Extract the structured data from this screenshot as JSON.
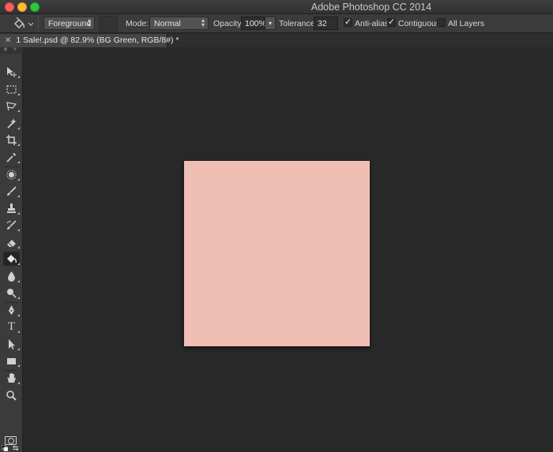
{
  "app": {
    "title": "Adobe Photoshop CC 2014"
  },
  "options_bar": {
    "fill_source": "Foreground",
    "mode_label": "Mode:",
    "mode_value": "Normal",
    "opacity_label": "Opacity:",
    "opacity_value": "100%",
    "tolerance_label": "Tolerance:",
    "tolerance_value": "32",
    "anti_alias_label": "Anti-alias",
    "anti_alias_checked": true,
    "contiguous_label": "Contiguous",
    "contiguous_checked": true,
    "all_layers_label": "All Layers",
    "all_layers_checked": false
  },
  "document_tab": {
    "title": "1 Sale!.psd @ 82.9% (BG Green, RGB/8#) *"
  },
  "toolbar": {
    "active_tool": "paint-bucket-tool",
    "tools": [
      "move-tool",
      "marquee-tool",
      "lasso-tool",
      "magic-wand-tool",
      "crop-tool",
      "eyedropper-tool",
      "spot-healing-tool",
      "brush-tool",
      "clone-stamp-tool",
      "history-brush-tool",
      "eraser-tool",
      "paint-bucket-tool",
      "blur-tool",
      "dodge-tool",
      "pen-tool",
      "type-tool",
      "path-selection-tool",
      "rectangle-tool",
      "hand-tool",
      "zoom-tool"
    ],
    "type_tool_glyph": "T"
  },
  "colors": {
    "foreground": "#f0c0b5",
    "background": "#ffffff",
    "canvas_fill": "#efbfb5",
    "workspace": "#282828"
  }
}
